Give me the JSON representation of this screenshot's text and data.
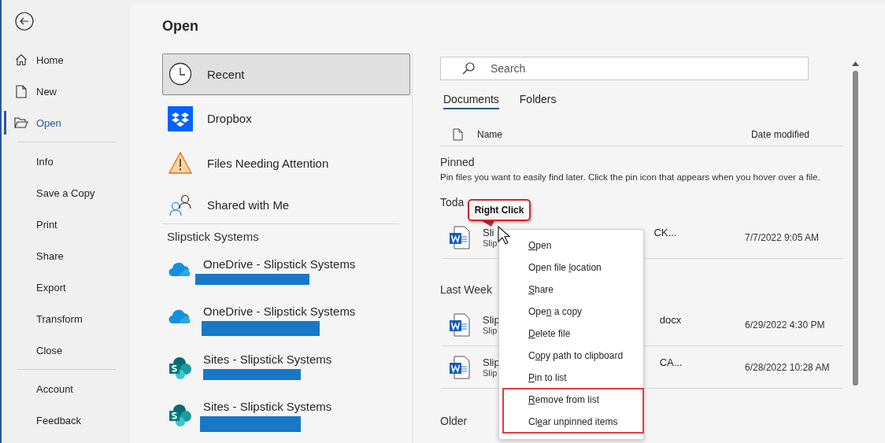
{
  "nav": [
    {
      "label": "Home",
      "selected": false
    },
    {
      "label": "New",
      "selected": false
    },
    {
      "label": "Open",
      "selected": true
    },
    {
      "kind": "divider"
    },
    {
      "label": "Info",
      "selected": false
    },
    {
      "label": "Save a Copy",
      "selected": false
    },
    {
      "label": "Print",
      "selected": false
    },
    {
      "label": "Share",
      "selected": false
    },
    {
      "label": "Export",
      "selected": false
    },
    {
      "label": "Transform",
      "selected": false
    },
    {
      "label": "Close",
      "selected": false
    },
    {
      "kind": "divider"
    },
    {
      "label": "Account",
      "selected": false
    },
    {
      "label": "Feedback",
      "selected": false
    }
  ],
  "title": "Open",
  "places": [
    {
      "label": "Recent",
      "selected": true
    },
    {
      "label": "Dropbox",
      "selected": false
    },
    {
      "label": "Files Needing Attention",
      "selected": false
    },
    {
      "label": "Shared with Me",
      "selected": false
    }
  ],
  "group": {
    "heading": "Slipstick Systems",
    "locations": [
      {
        "label": "OneDrive - Slipstick Systems",
        "kind": "onedrive",
        "redacted": true
      },
      {
        "label": "OneDrive - Slipstick Systems",
        "kind": "onedrive",
        "redacted": true
      },
      {
        "label": "Sites - Slipstick Systems",
        "kind": "sites",
        "redacted": true
      },
      {
        "label": "Sites - Slipstick Systems",
        "kind": "sites",
        "redacted": true
      }
    ]
  },
  "search": {
    "placeholder": "Search"
  },
  "tabs": [
    {
      "label": "Documents",
      "selected": true
    },
    {
      "label": "Folders",
      "selected": false
    }
  ],
  "columns": {
    "name": "Name",
    "date": "Date modified"
  },
  "pinned": {
    "heading": "Pinned",
    "description": "Pin files you want to easily find later. Click the pin icon that appears when you hover over a file."
  },
  "sections": [
    {
      "heading": "Toda",
      "files": [
        {
          "name_start": "Sli",
          "name_end": "CK...",
          "location": "Slip",
          "date": "7/7/2022 9:05 AM"
        }
      ]
    },
    {
      "heading": "Last Week",
      "files": [
        {
          "name_start": "Slip",
          "name_end": "docx",
          "location": "Slip",
          "date": "6/29/2022 4:30 PM"
        },
        {
          "name_start": "Slip",
          "name_end": "CA...",
          "location": "Slip",
          "date": "6/28/2022 10:28 AM"
        }
      ]
    },
    {
      "heading": "Older"
    }
  ],
  "callout": "Right Click",
  "context_menu": [
    {
      "key": "O",
      "after": "pen",
      "highlighted": false
    },
    {
      "before": "Open file ",
      "key": "l",
      "after": "ocation",
      "highlighted": false
    },
    {
      "key": "S",
      "after": "hare",
      "highlighted": false
    },
    {
      "before": "Ope",
      "key": "n",
      "after": " a copy",
      "highlighted": false
    },
    {
      "key": "D",
      "after": "elete file",
      "highlighted": false
    },
    {
      "before": "C",
      "key": "o",
      "after": "py path to clipboard",
      "highlighted": false
    },
    {
      "key": "P",
      "after": "in to list",
      "highlighted": false
    },
    {
      "key": "R",
      "after": "emove from list",
      "highlighted": true
    },
    {
      "before": "Cl",
      "key": "e",
      "after": "ar unpinned items",
      "highlighted": true
    }
  ]
}
